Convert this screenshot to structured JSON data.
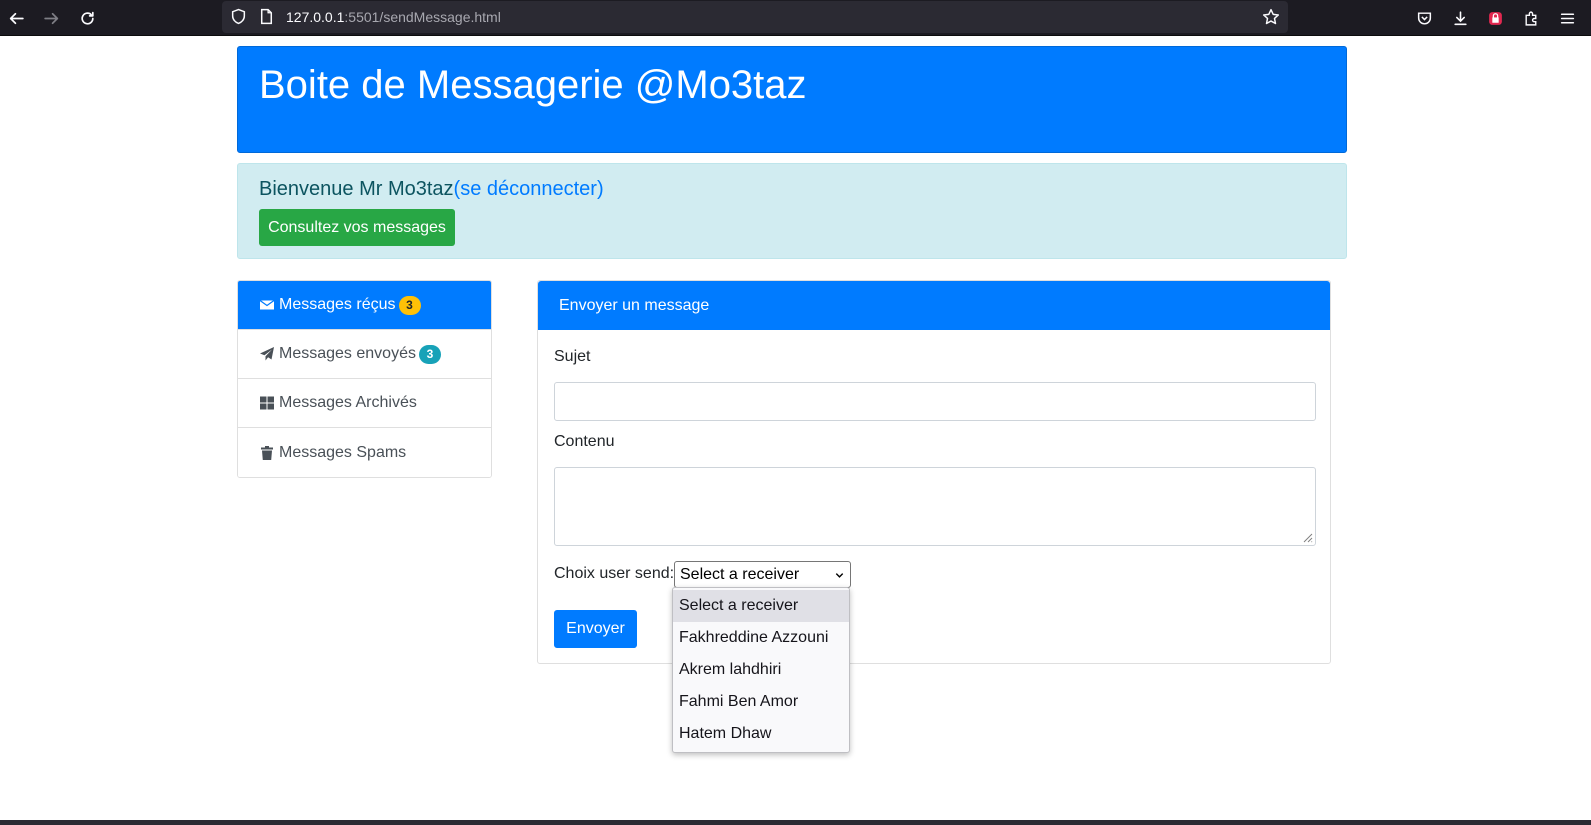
{
  "browser": {
    "url_host": "127.0.0.1",
    "url_rest": ":5501/sendMessage.html"
  },
  "header": {
    "title": "Boite de Messagerie @Mo3taz"
  },
  "welcome": {
    "text": "Bienvenue Mr Mo3taz",
    "logout_link": "(se déconnecter)",
    "consult_button": "Consultez vos messages"
  },
  "sidebar": {
    "items": [
      {
        "label": "Messages réçus",
        "badge": "3",
        "icon": "envelope-icon",
        "active": true
      },
      {
        "label": "Messages envoyés",
        "badge": "3",
        "icon": "paper-plane-icon",
        "active": false
      },
      {
        "label": "Messages Archivés",
        "icon": "grid-icon",
        "active": false
      },
      {
        "label": "Messages Spams",
        "icon": "trash-icon",
        "active": false
      }
    ]
  },
  "form": {
    "title": "Envoyer un message",
    "subject_label": "Sujet",
    "subject_value": "",
    "content_label": "Contenu",
    "content_value": "",
    "receiver_label": "Choix user send:",
    "receiver_selected": "Select a receiver",
    "receiver_options": [
      "Select a receiver",
      "Fakhreddine Azzouni",
      "Akrem lahdhiri",
      "Fahmi Ben Amor",
      "Hatem Dhaw"
    ],
    "submit_label": "Envoyer"
  },
  "colors": {
    "primary": "#007bff",
    "success": "#28a745",
    "info_bg": "#d1ecf1",
    "warning": "#ffc107",
    "info": "#17a2b8"
  }
}
